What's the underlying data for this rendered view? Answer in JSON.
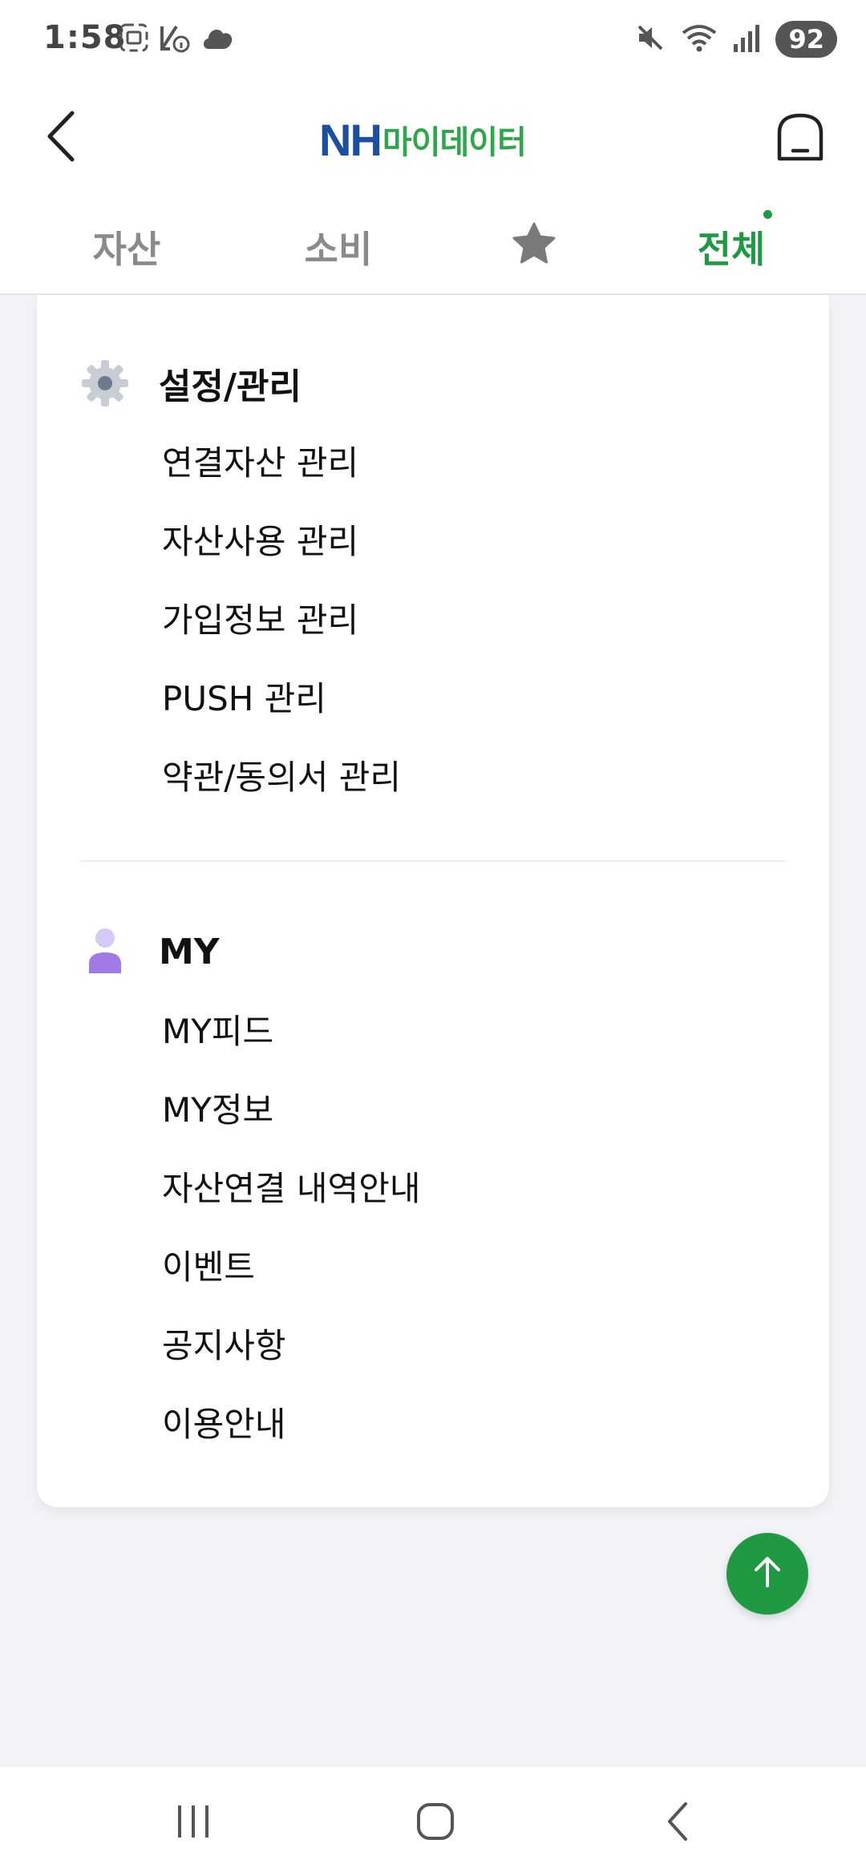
{
  "status_bar": {
    "time": "1:58",
    "battery": "92",
    "left_icons": [
      "screenshot-icon",
      "no-signal-info-icon",
      "cloud-icon"
    ],
    "right_icons": [
      "mute-icon",
      "wifi-icon",
      "signal-icon"
    ]
  },
  "header": {
    "logo_nh": "NH",
    "logo_text": "마이데이터",
    "back_icon": "chevron-left-icon",
    "home_icon": "home-icon"
  },
  "tabs": [
    {
      "label": "자산",
      "active": false
    },
    {
      "label": "소비",
      "active": false
    },
    {
      "label": "",
      "icon": "star-icon",
      "active": false
    },
    {
      "label": "전체",
      "active": true
    }
  ],
  "sections": [
    {
      "title": "설정/관리",
      "icon": "gear-icon",
      "items": [
        "연결자산 관리",
        "자산사용 관리",
        "가입정보 관리",
        "PUSH 관리",
        "약관/동의서 관리"
      ]
    },
    {
      "title": "MY",
      "icon": "person-icon",
      "items": [
        "MY피드",
        "MY정보",
        "자산연결 내역안내",
        "이벤트",
        "공지사항",
        "이용안내"
      ]
    }
  ],
  "colors": {
    "accent": "#1f9a43",
    "logo_blue": "#1c4fa0",
    "background": "#f1f3f7"
  }
}
